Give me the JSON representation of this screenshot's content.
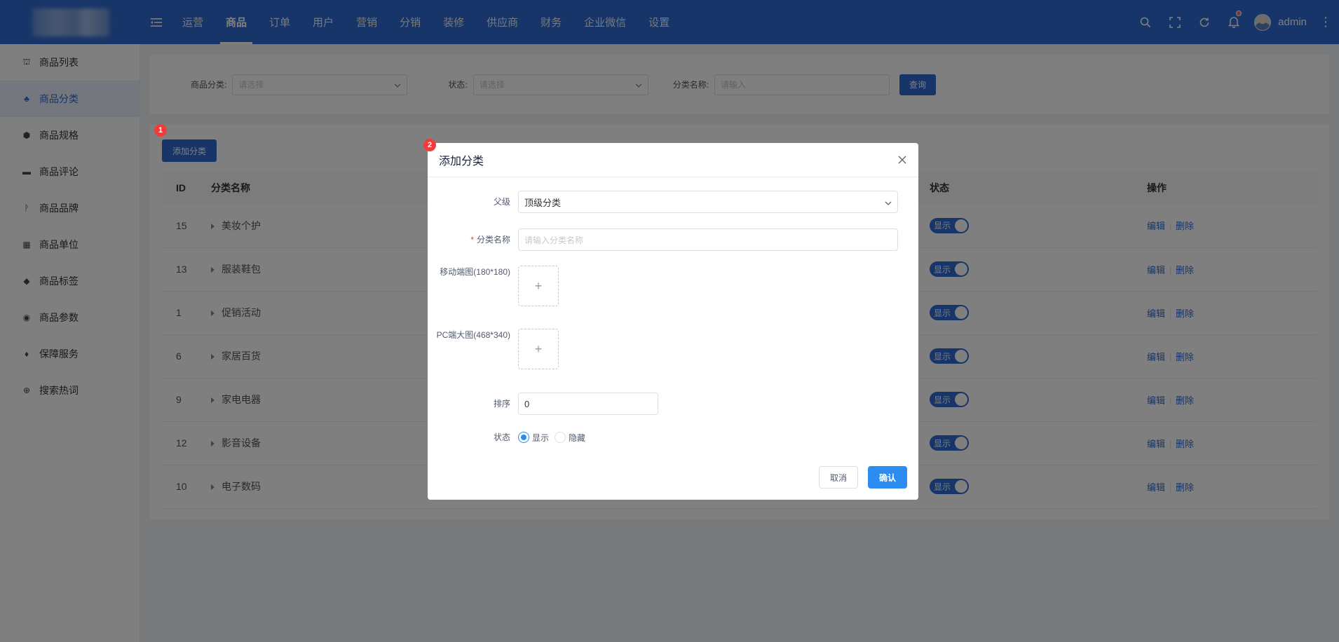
{
  "topbar": {
    "nav": [
      "运营",
      "商品",
      "订单",
      "用户",
      "营销",
      "分销",
      "装修",
      "供应商",
      "财务",
      "企业微信",
      "设置"
    ],
    "active_nav": "商品",
    "user_name": "admin",
    "icons": [
      "search-icon",
      "fullscreen-icon",
      "refresh-icon",
      "bell-icon"
    ]
  },
  "sidebar": {
    "items": [
      {
        "label": "商品列表",
        "icon": "basket-icon"
      },
      {
        "label": "商品分类",
        "icon": "category-icon",
        "active": true
      },
      {
        "label": "商品规格",
        "icon": "cube-icon"
      },
      {
        "label": "商品评论",
        "icon": "comment-icon"
      },
      {
        "label": "商品品牌",
        "icon": "brand-icon"
      },
      {
        "label": "商品单位",
        "icon": "grid-icon"
      },
      {
        "label": "商品标签",
        "icon": "tag-icon"
      },
      {
        "label": "商品参数",
        "icon": "eye-icon"
      },
      {
        "label": "保障服务",
        "icon": "pin-icon"
      },
      {
        "label": "搜索热词",
        "icon": "globe-icon"
      }
    ]
  },
  "filters": {
    "category_label": "商品分类:",
    "category_placeholder": "请选择",
    "status_label": "状态:",
    "status_placeholder": "请选择",
    "name_label": "分类名称:",
    "name_placeholder": "请输入",
    "query_button": "查询"
  },
  "table": {
    "add_button": "添加分类",
    "headers": {
      "id": "ID",
      "name": "分类名称",
      "status": "状态",
      "actions": "操作"
    },
    "rows": [
      {
        "id": "15",
        "name": "美妆个护",
        "status": "显示"
      },
      {
        "id": "13",
        "name": "服装鞋包",
        "status": "显示"
      },
      {
        "id": "1",
        "name": "促销活动",
        "status": "显示"
      },
      {
        "id": "6",
        "name": "家居百货",
        "status": "显示"
      },
      {
        "id": "9",
        "name": "家电电器",
        "status": "显示"
      },
      {
        "id": "12",
        "name": "影音设备",
        "status": "显示"
      },
      {
        "id": "10",
        "name": "电子数码",
        "status": "显示"
      }
    ],
    "edit_label": "编辑",
    "delete_label": "删除"
  },
  "badges": {
    "first": "1",
    "second": "2"
  },
  "modal": {
    "title": "添加分类",
    "parent_label": "父级",
    "parent_value": "顶级分类",
    "name_label": "分类名称",
    "name_placeholder": "请输入分类名称",
    "mobile_image_label": "移动端图(180*180)",
    "pc_image_label": "PC端大图(468*340)",
    "sort_label": "排序",
    "sort_value": "0",
    "status_label": "状态",
    "status_show": "显示",
    "status_hide": "隐藏",
    "status_selected": "显示",
    "cancel_button": "取消",
    "confirm_button": "确认",
    "upload_symbol": "+"
  },
  "colors": {
    "primary": "#2f6bd0",
    "modal_primary": "#2d8cf0",
    "badge": "#f23c3c"
  }
}
